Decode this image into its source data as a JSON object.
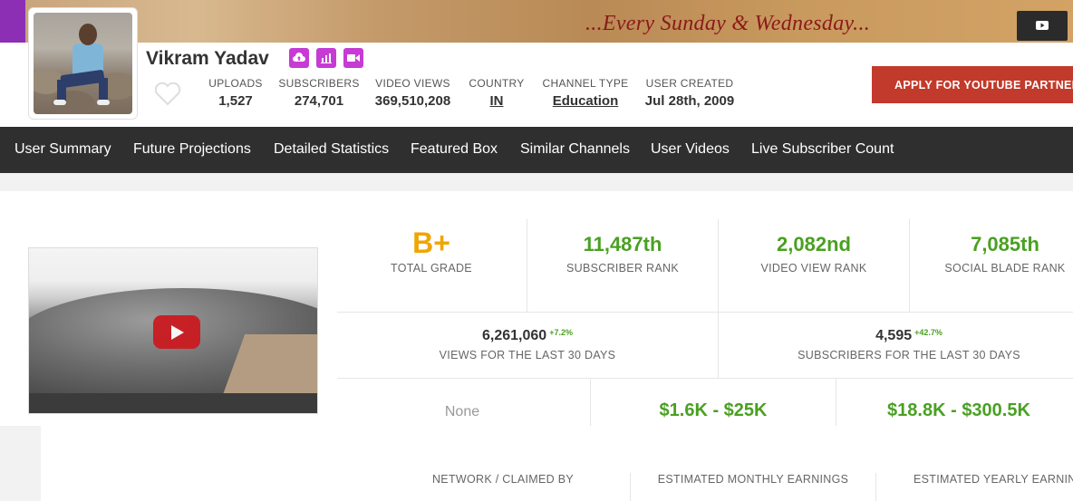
{
  "banner": {
    "tagline": "...Every Sunday & Wednesday..."
  },
  "channel": {
    "name": "Vikram Yadav",
    "stats": [
      {
        "label": "UPLOADS",
        "value": "1,527"
      },
      {
        "label": "SUBSCRIBERS",
        "value": "274,701"
      },
      {
        "label": "VIDEO VIEWS",
        "value": "369,510,208"
      },
      {
        "label": "COUNTRY",
        "value": "IN"
      },
      {
        "label": "CHANNEL TYPE",
        "value": "Education"
      },
      {
        "label": "USER CREATED",
        "value": "Jul 28th, 2009"
      }
    ],
    "apply_button": "APPLY FOR YOUTUBE PARTNER"
  },
  "nav": [
    "User Summary",
    "Future Projections",
    "Detailed Statistics",
    "Featured Box",
    "Similar Channels",
    "User Videos",
    "Live Subscriber Count"
  ],
  "summary": {
    "grade": {
      "value": "B+",
      "label": "TOTAL GRADE"
    },
    "subscriber_rank": {
      "value": "11,487th",
      "label": "SUBSCRIBER RANK"
    },
    "video_view_rank": {
      "value": "2,082nd",
      "label": "VIDEO VIEW RANK"
    },
    "socialblade_rank": {
      "value": "7,085th",
      "label": "SOCIAL BLADE RANK"
    },
    "views_30": {
      "value": "6,261,060",
      "change": "+7.2%",
      "label": "VIEWS FOR THE LAST 30 DAYS"
    },
    "subs_30": {
      "value": "4,595",
      "change": "+42.7%",
      "label": "SUBSCRIBERS FOR THE LAST 30 DAYS"
    },
    "network": {
      "value": "None",
      "label": "NETWORK / CLAIMED BY"
    },
    "monthly": {
      "value": "$1.6K - $25K",
      "label": "ESTIMATED MONTHLY EARNINGS"
    },
    "yearly": {
      "value": "$18.8K - $300.5K",
      "label": "ESTIMATED YEARLY EARNINGS"
    }
  },
  "colors": {
    "accent_green": "#4aa022",
    "grade_orange": "#f0a500",
    "badge_purple": "#c63bd4",
    "apply_red": "#c23a2b",
    "nav_bg": "#2f2f2f"
  },
  "icons": [
    "youtube-icon",
    "upload-icon",
    "chart-icon",
    "video-camera-icon",
    "heart-icon",
    "play-icon"
  ]
}
